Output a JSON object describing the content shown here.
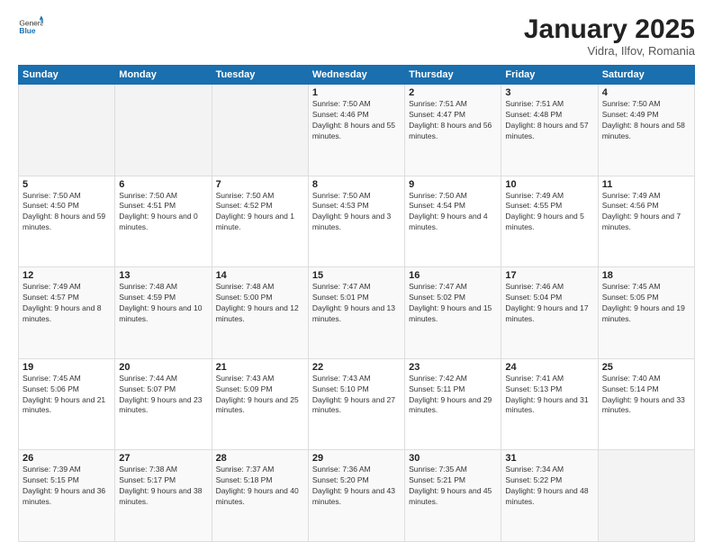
{
  "header": {
    "logo_general": "General",
    "logo_blue": "Blue",
    "title": "January 2025",
    "location": "Vidra, Ilfov, Romania"
  },
  "weekdays": [
    "Sunday",
    "Monday",
    "Tuesday",
    "Wednesday",
    "Thursday",
    "Friday",
    "Saturday"
  ],
  "weeks": [
    [
      {
        "day": "",
        "sunrise": "",
        "sunset": "",
        "daylight": ""
      },
      {
        "day": "",
        "sunrise": "",
        "sunset": "",
        "daylight": ""
      },
      {
        "day": "",
        "sunrise": "",
        "sunset": "",
        "daylight": ""
      },
      {
        "day": "1",
        "sunrise": "7:50 AM",
        "sunset": "4:46 PM",
        "daylight": "8 hours and 55 minutes."
      },
      {
        "day": "2",
        "sunrise": "7:51 AM",
        "sunset": "4:47 PM",
        "daylight": "8 hours and 56 minutes."
      },
      {
        "day": "3",
        "sunrise": "7:51 AM",
        "sunset": "4:48 PM",
        "daylight": "8 hours and 57 minutes."
      },
      {
        "day": "4",
        "sunrise": "7:50 AM",
        "sunset": "4:49 PM",
        "daylight": "8 hours and 58 minutes."
      }
    ],
    [
      {
        "day": "5",
        "sunrise": "7:50 AM",
        "sunset": "4:50 PM",
        "daylight": "8 hours and 59 minutes."
      },
      {
        "day": "6",
        "sunrise": "7:50 AM",
        "sunset": "4:51 PM",
        "daylight": "9 hours and 0 minutes."
      },
      {
        "day": "7",
        "sunrise": "7:50 AM",
        "sunset": "4:52 PM",
        "daylight": "9 hours and 1 minute."
      },
      {
        "day": "8",
        "sunrise": "7:50 AM",
        "sunset": "4:53 PM",
        "daylight": "9 hours and 3 minutes."
      },
      {
        "day": "9",
        "sunrise": "7:50 AM",
        "sunset": "4:54 PM",
        "daylight": "9 hours and 4 minutes."
      },
      {
        "day": "10",
        "sunrise": "7:49 AM",
        "sunset": "4:55 PM",
        "daylight": "9 hours and 5 minutes."
      },
      {
        "day": "11",
        "sunrise": "7:49 AM",
        "sunset": "4:56 PM",
        "daylight": "9 hours and 7 minutes."
      }
    ],
    [
      {
        "day": "12",
        "sunrise": "7:49 AM",
        "sunset": "4:57 PM",
        "daylight": "9 hours and 8 minutes."
      },
      {
        "day": "13",
        "sunrise": "7:48 AM",
        "sunset": "4:59 PM",
        "daylight": "9 hours and 10 minutes."
      },
      {
        "day": "14",
        "sunrise": "7:48 AM",
        "sunset": "5:00 PM",
        "daylight": "9 hours and 12 minutes."
      },
      {
        "day": "15",
        "sunrise": "7:47 AM",
        "sunset": "5:01 PM",
        "daylight": "9 hours and 13 minutes."
      },
      {
        "day": "16",
        "sunrise": "7:47 AM",
        "sunset": "5:02 PM",
        "daylight": "9 hours and 15 minutes."
      },
      {
        "day": "17",
        "sunrise": "7:46 AM",
        "sunset": "5:04 PM",
        "daylight": "9 hours and 17 minutes."
      },
      {
        "day": "18",
        "sunrise": "7:45 AM",
        "sunset": "5:05 PM",
        "daylight": "9 hours and 19 minutes."
      }
    ],
    [
      {
        "day": "19",
        "sunrise": "7:45 AM",
        "sunset": "5:06 PM",
        "daylight": "9 hours and 21 minutes."
      },
      {
        "day": "20",
        "sunrise": "7:44 AM",
        "sunset": "5:07 PM",
        "daylight": "9 hours and 23 minutes."
      },
      {
        "day": "21",
        "sunrise": "7:43 AM",
        "sunset": "5:09 PM",
        "daylight": "9 hours and 25 minutes."
      },
      {
        "day": "22",
        "sunrise": "7:43 AM",
        "sunset": "5:10 PM",
        "daylight": "9 hours and 27 minutes."
      },
      {
        "day": "23",
        "sunrise": "7:42 AM",
        "sunset": "5:11 PM",
        "daylight": "9 hours and 29 minutes."
      },
      {
        "day": "24",
        "sunrise": "7:41 AM",
        "sunset": "5:13 PM",
        "daylight": "9 hours and 31 minutes."
      },
      {
        "day": "25",
        "sunrise": "7:40 AM",
        "sunset": "5:14 PM",
        "daylight": "9 hours and 33 minutes."
      }
    ],
    [
      {
        "day": "26",
        "sunrise": "7:39 AM",
        "sunset": "5:15 PM",
        "daylight": "9 hours and 36 minutes."
      },
      {
        "day": "27",
        "sunrise": "7:38 AM",
        "sunset": "5:17 PM",
        "daylight": "9 hours and 38 minutes."
      },
      {
        "day": "28",
        "sunrise": "7:37 AM",
        "sunset": "5:18 PM",
        "daylight": "9 hours and 40 minutes."
      },
      {
        "day": "29",
        "sunrise": "7:36 AM",
        "sunset": "5:20 PM",
        "daylight": "9 hours and 43 minutes."
      },
      {
        "day": "30",
        "sunrise": "7:35 AM",
        "sunset": "5:21 PM",
        "daylight": "9 hours and 45 minutes."
      },
      {
        "day": "31",
        "sunrise": "7:34 AM",
        "sunset": "5:22 PM",
        "daylight": "9 hours and 48 minutes."
      },
      {
        "day": "",
        "sunrise": "",
        "sunset": "",
        "daylight": ""
      }
    ]
  ]
}
